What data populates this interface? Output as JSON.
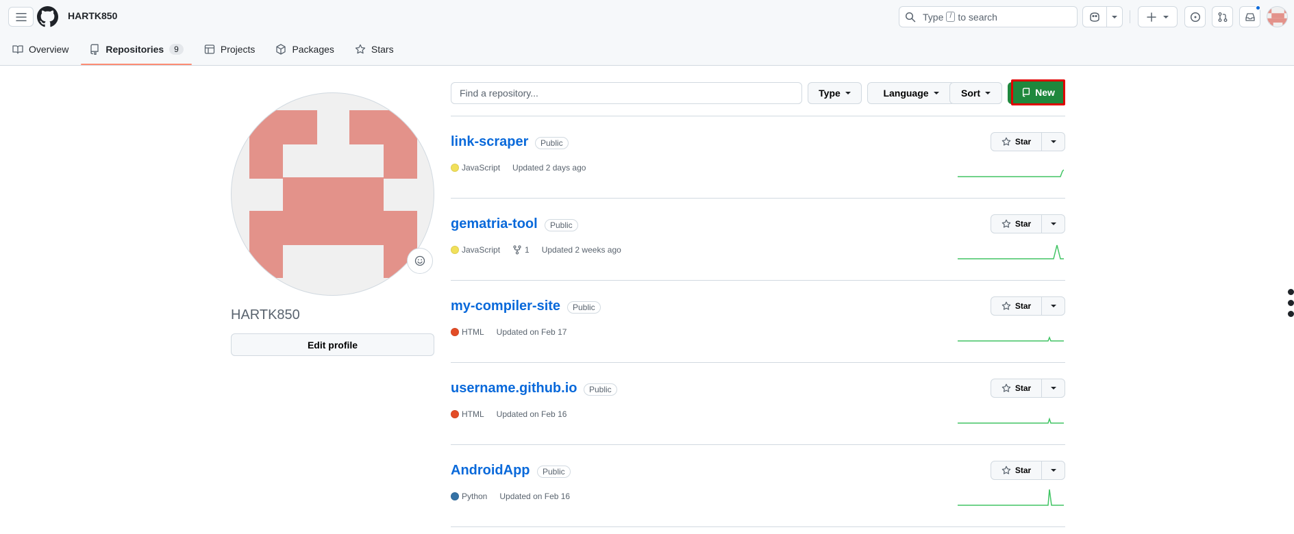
{
  "header": {
    "owner": "HARTK850",
    "search": {
      "prefix": "Type",
      "key": "/",
      "suffix": "to search"
    }
  },
  "tabs": [
    {
      "label": "Overview",
      "icon": "book-icon"
    },
    {
      "label": "Repositories",
      "icon": "repo-icon",
      "count": "9",
      "active": true
    },
    {
      "label": "Projects",
      "icon": "table-icon"
    },
    {
      "label": "Packages",
      "icon": "package-icon"
    },
    {
      "label": "Stars",
      "icon": "star-icon"
    }
  ],
  "profile": {
    "name": "HARTK850",
    "edit_label": "Edit profile",
    "avatar_color": "#e3928a"
  },
  "toolbar": {
    "find_placeholder": "Find a repository...",
    "type_label": "Type",
    "language_label": "Language",
    "sort_label": "Sort",
    "new_label": "New"
  },
  "repos": [
    {
      "name": "link-scraper",
      "visibility": "Public",
      "language": "JavaScript",
      "lang_color": "#f1e05a",
      "forks": "",
      "updated": "Updated 2 days ago",
      "star_label": "Star"
    },
    {
      "name": "gematria-tool",
      "visibility": "Public",
      "language": "JavaScript",
      "lang_color": "#f1e05a",
      "forks": "1",
      "updated": "Updated 2 weeks ago",
      "star_label": "Star"
    },
    {
      "name": "my-compiler-site",
      "visibility": "Public",
      "language": "HTML",
      "lang_color": "#e34c26",
      "forks": "",
      "updated": "Updated on Feb 17",
      "star_label": "Star"
    },
    {
      "name": "username.github.io",
      "visibility": "Public",
      "language": "HTML",
      "lang_color": "#e34c26",
      "forks": "",
      "updated": "Updated on Feb 16",
      "star_label": "Star"
    },
    {
      "name": "AndroidApp",
      "visibility": "Public",
      "language": "Python",
      "lang_color": "#3572a5",
      "forks": "",
      "updated": "Updated on Feb 16",
      "star_label": "Star"
    }
  ],
  "colors": {
    "link": "#0969da",
    "success": "#1f883d",
    "spark": "#40c463"
  }
}
